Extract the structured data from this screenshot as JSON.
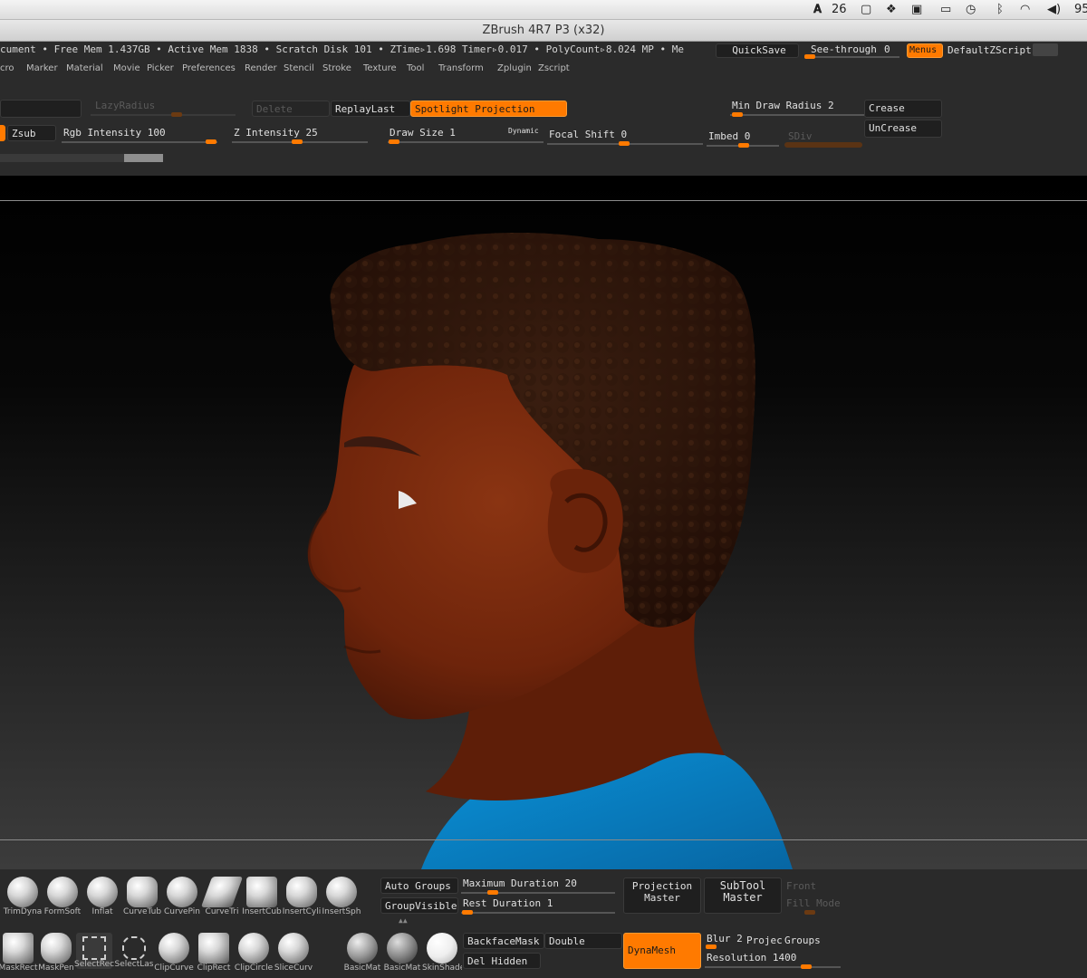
{
  "menubar": {
    "adobe_count": "26",
    "battery": "95"
  },
  "window": {
    "title": "ZBrush 4R7 P3 (x32)"
  },
  "infobar": {
    "text": "cument  • Free Mem 1.437GB • Active Mem 1838 • Scratch Disk 101 • ZTime▹1.698 Timer▹0.017 • PolyCount▹8.024 MP • Me"
  },
  "top_right": {
    "quicksave": "QuickSave",
    "see_through": "See-through",
    "see_through_value": "0",
    "menus": "Menus",
    "default_zscript": "DefaultZScript"
  },
  "menus": [
    "cro",
    "Marker",
    "Material",
    "Movie",
    "Picker",
    "Preferences",
    "Render",
    "Stencil",
    "Stroke",
    "Texture",
    "Tool",
    "Transform",
    "Zplugin",
    "Zscript"
  ],
  "toolbar": {
    "lazy_radius": "LazyRadius",
    "delete": "Delete",
    "replay_last": "ReplayLast",
    "spotlight": "Spotlight Projection",
    "min_draw_radius": "Min Draw Radius 2",
    "crease": "Crease",
    "uncrease": "UnCrease",
    "zsub": "Zsub",
    "rgb_intensity": "Rgb Intensity 100",
    "z_intensity": "Z Intensity 25",
    "draw_size": "Draw Size 1",
    "dynamic": "Dynamic",
    "focal_shift": "Focal Shift 0",
    "imbed": "Imbed 0",
    "sdiv": "SDiv"
  },
  "brushes": [
    "TrimDyna",
    "FormSoft",
    "Inflat",
    "CurveTub",
    "CurvePin",
    "CurveTri",
    "InsertCub",
    "InsertCyli",
    "InsertSph"
  ],
  "brushes2": [
    "MaskRect",
    "MaskPen",
    "SelectRec",
    "SelectLas",
    "ClipCurve",
    "ClipRect",
    "ClipCircle",
    "SliceCurv"
  ],
  "materials": [
    "BasicMat",
    "BasicMat",
    "SkinShade"
  ],
  "bottom": {
    "auto_groups": "Auto Groups",
    "group_visible": "GroupVisible",
    "max_duration": "Maximum Duration 20",
    "rest_duration": "Rest Duration 1",
    "projection_master_1": "Projection",
    "projection_master_2": "Master",
    "subtool_master_1": "SubTool",
    "subtool_master_2": "Master",
    "front": "Front",
    "fill_mode": "Fill Mode",
    "backface_mask": "BackfaceMask",
    "double": "Double",
    "del_hidden": "Del Hidden",
    "dynamesh": "DynaMesh",
    "blur": "Blur 2",
    "project": "Projec",
    "groups": "Groups",
    "resolution": "Resolution 1400"
  },
  "colors": {
    "accent": "#ff7a00",
    "skin": "#7a2a0e",
    "shirt": "#0b7fc4",
    "hair": "#2c1409"
  }
}
